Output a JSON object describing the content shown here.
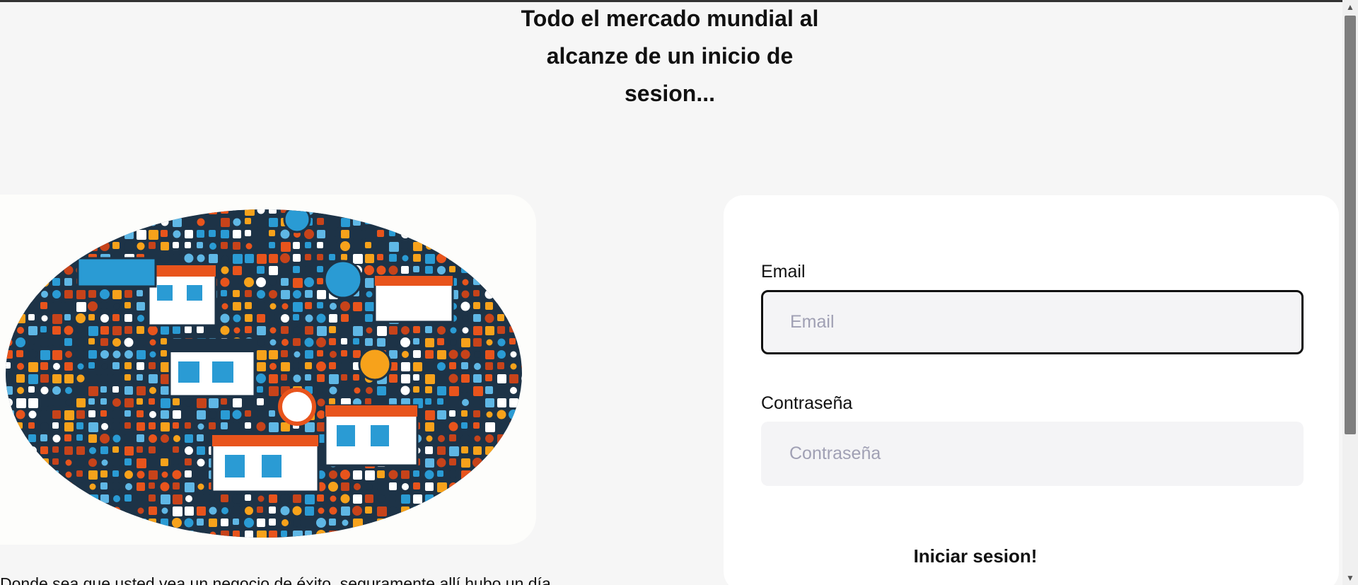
{
  "page": {
    "title": "Todo el mercado mundial al alcanze de un inicio de sesion...",
    "hero_image_alt": "market-illustration",
    "intro_text": "Donde sea que usted vea un negocio de éxito, seguramente allí hubo un día"
  },
  "form": {
    "email_label": "Email",
    "email_placeholder": "Email",
    "email_value": "",
    "password_label": "Contraseña",
    "password_placeholder": "Contraseña",
    "password_value": "",
    "submit_label": "Iniciar sesion!"
  },
  "scrollbar": {
    "up_icon": "chevron-up-icon",
    "down_icon": "chevron-down-icon"
  },
  "colors": {
    "page_bg": "#f6f6f6",
    "card_bg": "#ffffff",
    "field_bg": "#f4f4f6",
    "placeholder": "#a0a0b4",
    "text": "#111111",
    "focus_border": "#111111"
  }
}
